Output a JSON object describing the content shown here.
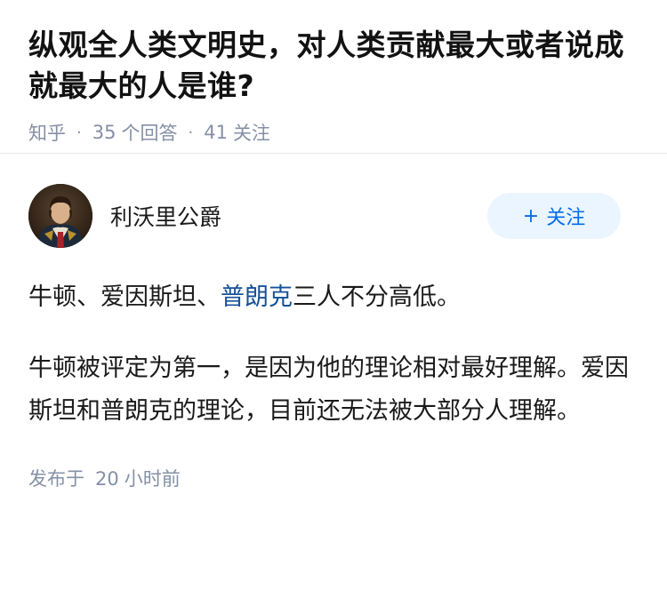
{
  "question": {
    "title": "纵观全人类文明史，对人类贡献最大或者说成就最大的人是谁?",
    "source": "知乎",
    "answer_count": "35",
    "answer_label": "个回答",
    "follower_count": "41",
    "follower_label": "关注"
  },
  "answer": {
    "author_name": "利沃里公爵",
    "follow_label": "关注",
    "follow_icon": "plus-icon",
    "paragraph1_a": "牛顿、爱因斯坦、",
    "paragraph1_link": "普朗克",
    "paragraph1_b": "三人不分高低。",
    "paragraph2": "牛顿被评定为第一，是因为他的理论相对最好理解。爱因斯坦和普朗克的理论，目前还无法被大部分人理解。",
    "published_label": "发布于",
    "published_num": "20",
    "published_unit": "小时前"
  },
  "colors": {
    "accent": "#056de8",
    "link": "#175199",
    "meta": "#8590a6",
    "follow_bg": "#ebf5ff"
  }
}
